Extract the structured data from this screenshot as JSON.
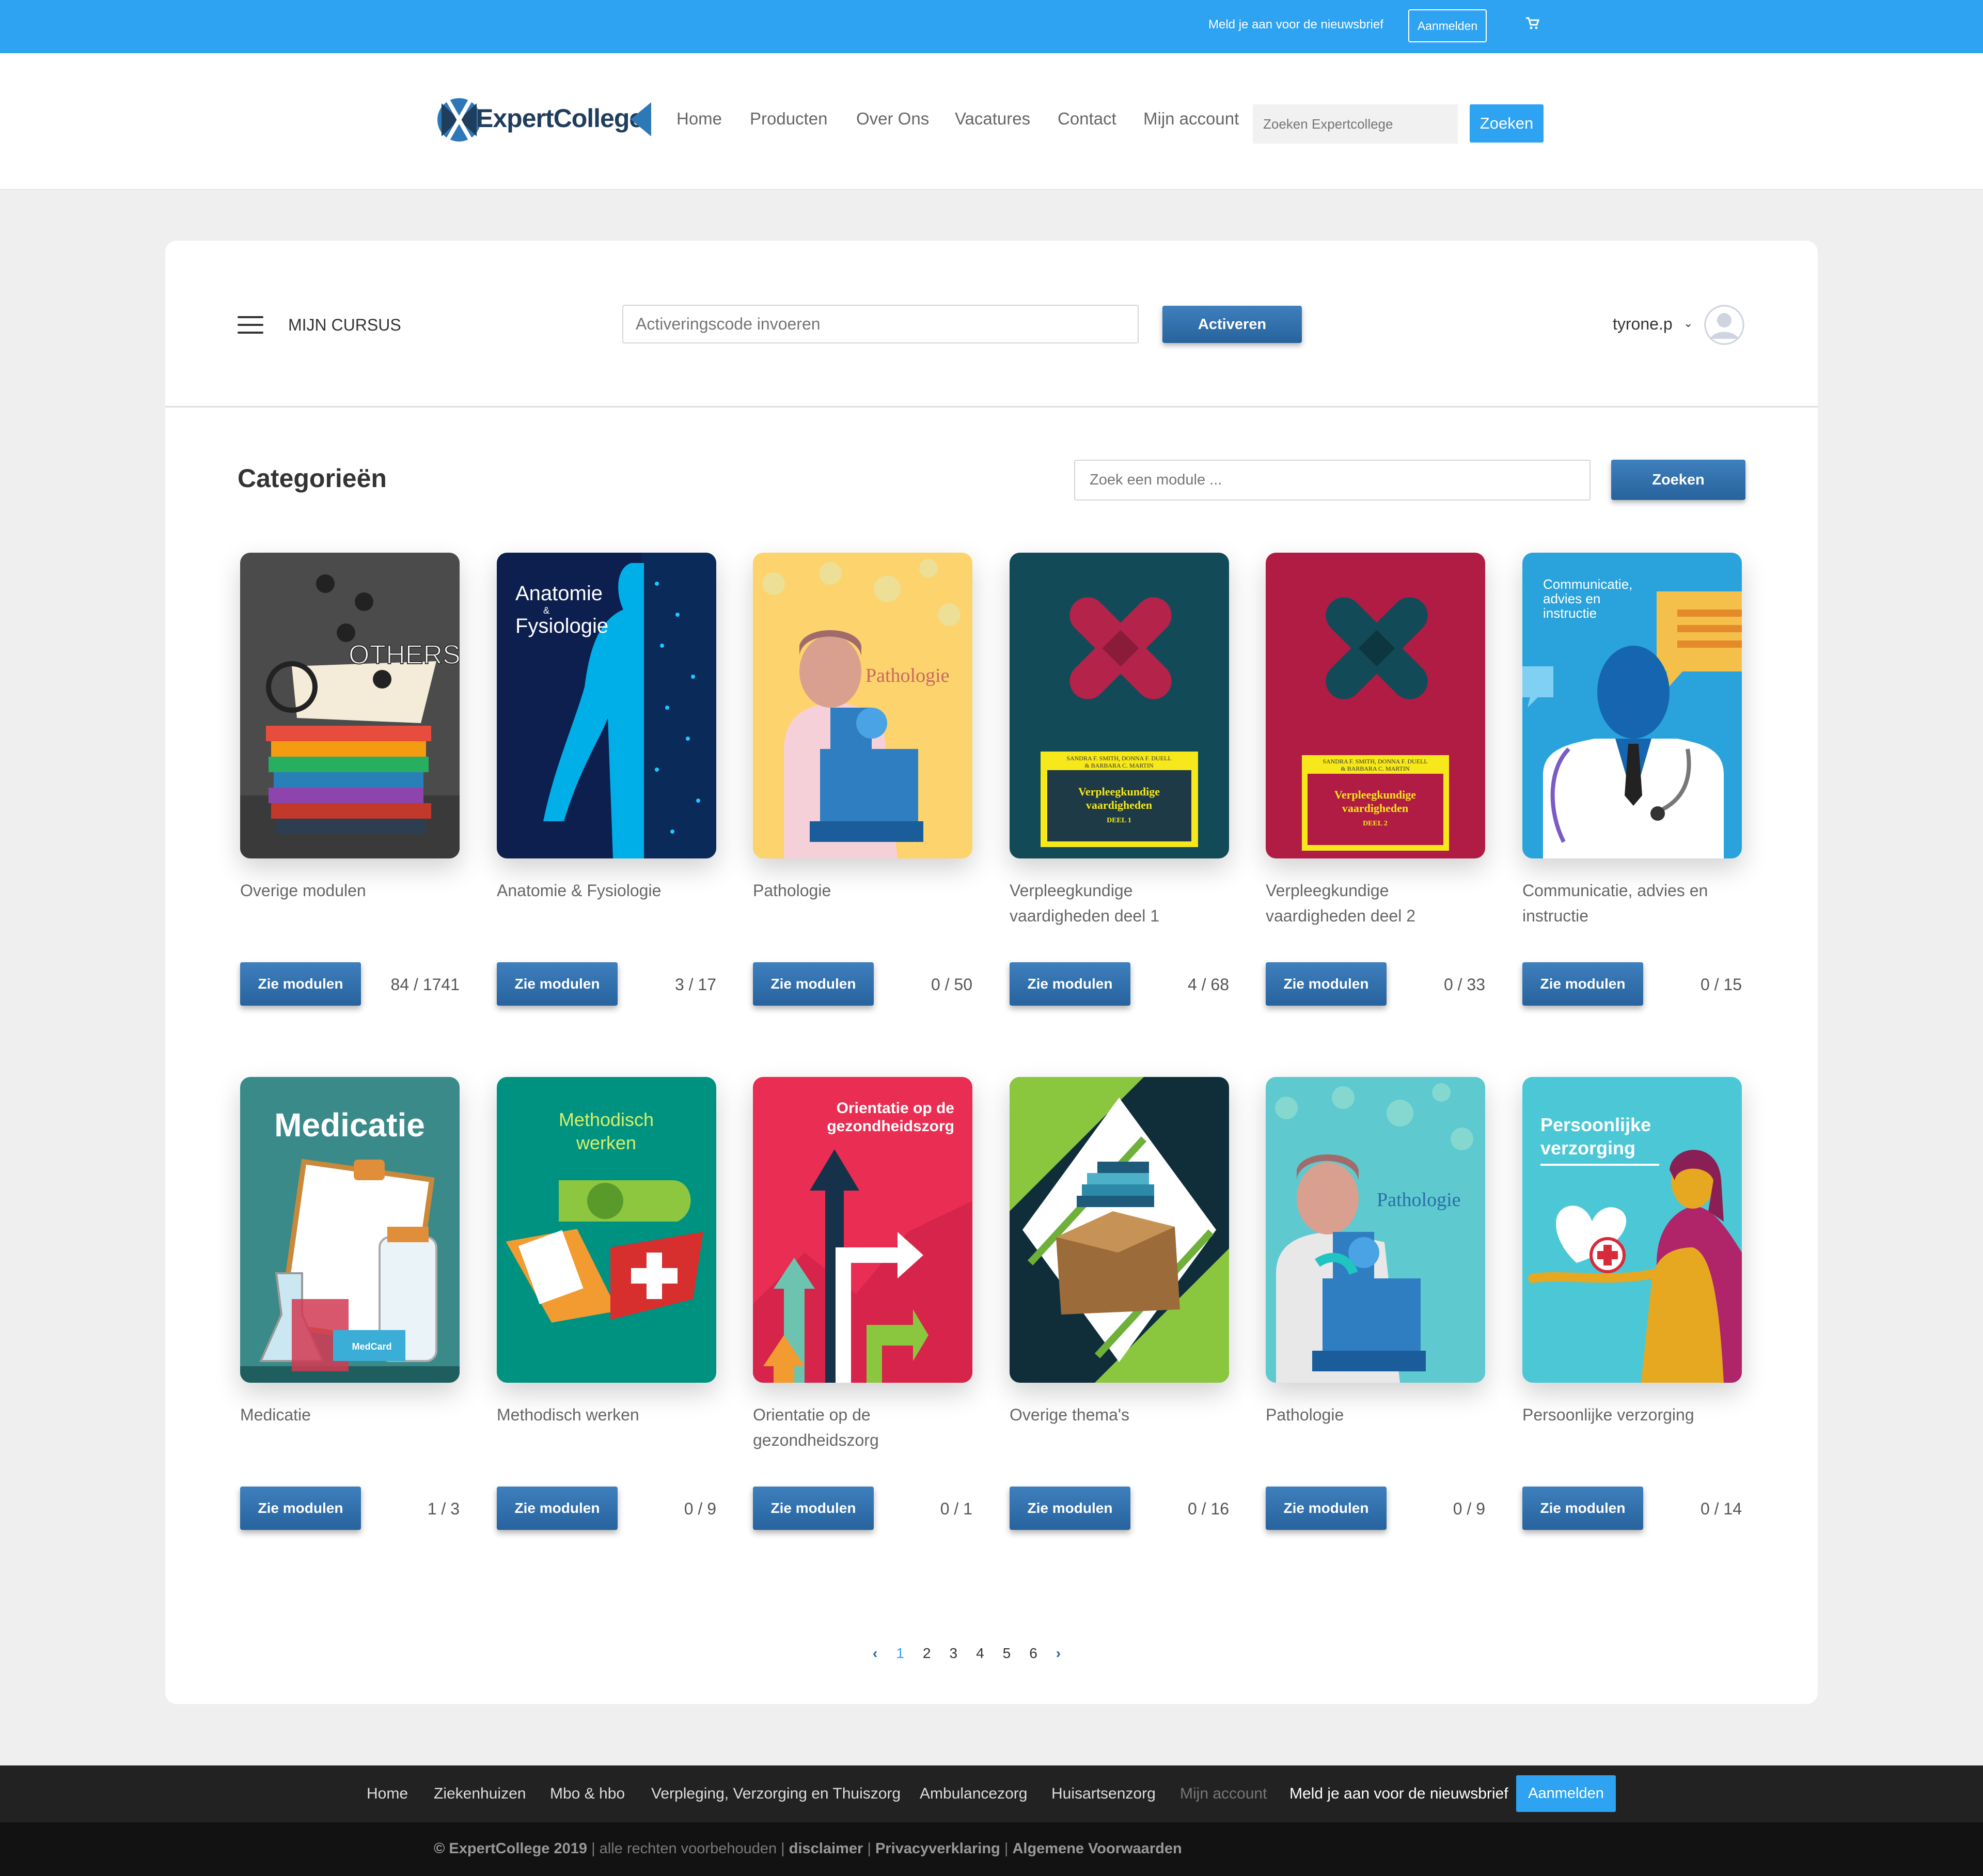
{
  "topbar": {
    "newsletter_text": "Meld je aan voor de nieuwsbrief",
    "newsletter_button": "Aanmelden"
  },
  "header": {
    "logo_text": "ExpertCollege",
    "nav": [
      "Home",
      "Producten",
      "Over Ons",
      "Vacatures",
      "Contact",
      "Mijn account"
    ],
    "search_placeholder": "Zoeken Expertcollege",
    "search_button": "Zoeken"
  },
  "course_bar": {
    "title": "MIJN CURSUS",
    "activation_placeholder": "Activeringscode invoeren",
    "activate_button": "Activeren",
    "username": "tyrone.p",
    "chevron": "⌄"
  },
  "categories": {
    "title": "Categorieën",
    "search_placeholder": "Zoek een module ...",
    "search_button": "Zoeken",
    "button_label": "Zie modulen",
    "items": [
      {
        "name": "Overige modulen",
        "count": "84 / 1741"
      },
      {
        "name": "Anatomie & Fysiologie",
        "count": "3 / 17"
      },
      {
        "name": "Pathologie",
        "count": "0 / 50"
      },
      {
        "name": "Verpleegkundige vaardigheden deel 1",
        "count": "4 / 68"
      },
      {
        "name": "Verpleegkundige vaardigheden deel 2",
        "count": "0 / 33"
      },
      {
        "name": "Communicatie, advies en instructie",
        "count": "0 / 15"
      },
      {
        "name": "Medicatie",
        "count": "1 / 3"
      },
      {
        "name": "Methodisch werken",
        "count": "0 / 9"
      },
      {
        "name": "Orientatie op de gezondheidszorg",
        "count": "0 / 1"
      },
      {
        "name": "Overige thema's",
        "count": "0 / 16"
      },
      {
        "name": "Pathologie",
        "count": "0 / 9"
      },
      {
        "name": "Persoonlijke verzorging",
        "count": "0 / 14"
      }
    ]
  },
  "covers": {
    "others": "OTHERS",
    "anatomie_1": "Anatomie",
    "anatomie_amp": "&",
    "anatomie_2": "Fysiologie",
    "pathologie": "Pathologie",
    "book_authors": "SANDRA F. SMITH, DONNA F. DUELL",
    "book_authors_2": "& BARBARA C. MARTIN",
    "book_title_1": "Verpleegkundige",
    "book_title_2": "vaardigheden",
    "book_deel_1": "DEEL 1",
    "book_deel_2": "DEEL 2",
    "comm_1": "Communicatie,",
    "comm_2": "advies en",
    "comm_3": "instructie",
    "medicatie": "Medicatie",
    "medcard": "MedCard",
    "methodisch_1": "Methodisch",
    "methodisch_2": "werken",
    "orientatie_1": "Orientatie op de",
    "orientatie_2": "gezondheidszorg",
    "persoonlijke_1": "Persoonlijke",
    "persoonlijke_2": "verzorging"
  },
  "pagination": {
    "prev": "‹",
    "pages": [
      "1",
      "2",
      "3",
      "4",
      "5",
      "6"
    ],
    "next": "›",
    "current": "1"
  },
  "footer": {
    "nav": [
      "Home",
      "Ziekenhuizen",
      "Mbo & hbo",
      "Verpleging, Verzorging en Thuiszorg",
      "Ambulancezorg",
      "Huisartsenzorg",
      "Mijn account"
    ],
    "newsletter_text": "Meld je aan voor de nieuwsbrief",
    "newsletter_button": "Aanmelden",
    "copyright": "© ExpertCollege 2019",
    "rights": "alle rechten voorbehouden",
    "sep": "|",
    "links": [
      "disclaimer",
      "Privacyverklaring",
      "Algemene Voorwaarden"
    ]
  },
  "colors": {
    "accent": "#2ea3f2",
    "button_dark": "#27639d",
    "footer": "#222222"
  }
}
